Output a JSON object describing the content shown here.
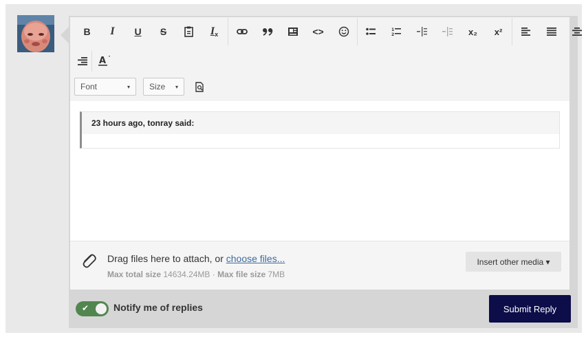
{
  "toolbar": {
    "row1": [
      {
        "name": "bold-button",
        "glyph": "B"
      },
      {
        "name": "italic-button",
        "glyph": "I"
      },
      {
        "name": "underline-button",
        "glyph": "U"
      },
      {
        "name": "strikethrough-button",
        "glyph": "S"
      },
      {
        "name": "paste-button",
        "glyph": ""
      },
      {
        "name": "remove-format-button",
        "glyph": "I"
      },
      {
        "name": "link-button",
        "glyph": "⚭"
      },
      {
        "name": "blockquote-button",
        "glyph": "❞"
      },
      {
        "name": "media-button",
        "glyph": ""
      },
      {
        "name": "code-button",
        "glyph": "<>"
      },
      {
        "name": "emoji-button",
        "glyph": "☺"
      },
      {
        "name": "bulleted-list-button",
        "glyph": ""
      },
      {
        "name": "numbered-list-button",
        "glyph": ""
      },
      {
        "name": "indent-button",
        "glyph": ""
      },
      {
        "name": "outdent-button",
        "glyph": ""
      },
      {
        "name": "subscript-button",
        "glyph": "x₂"
      },
      {
        "name": "superscript-button",
        "glyph": "x²"
      },
      {
        "name": "align-left-button",
        "glyph": ""
      },
      {
        "name": "justify-button",
        "glyph": ""
      },
      {
        "name": "align-center-button",
        "glyph": ""
      }
    ],
    "font_label": "Font",
    "size_label": "Size"
  },
  "quote": {
    "header": "23 hours ago, tonray said:"
  },
  "attach": {
    "prefix": "Drag files here to attach, or ",
    "link": "choose files...",
    "max_total_label": "Max total size",
    "max_total_value": "14634.24MB",
    "separator": " · ",
    "max_file_label": "Max file size",
    "max_file_value": "7MB",
    "media_button": "Insert other media ▾"
  },
  "footer": {
    "notify_label": "Notify me of replies",
    "submit_label": "Submit Reply"
  },
  "colors": {
    "submit_bg": "#0d0d4a",
    "toggle_bg": "#52864f",
    "link": "#3d6a9e"
  }
}
